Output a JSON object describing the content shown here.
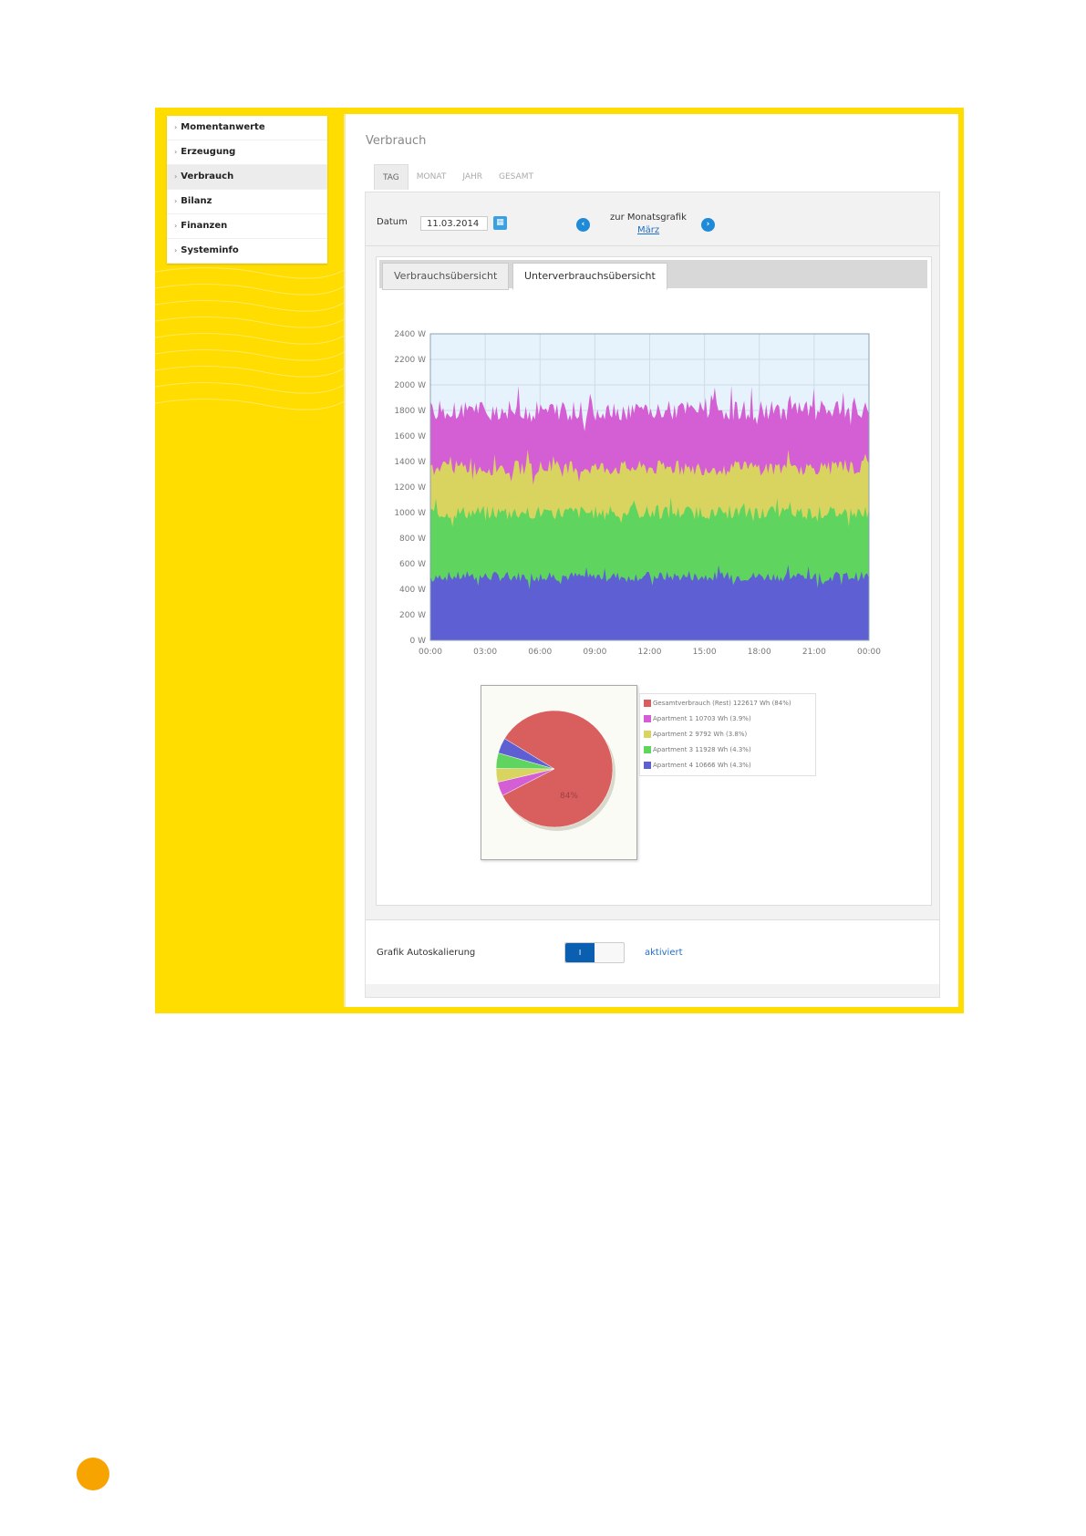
{
  "sidebar": {
    "items": [
      {
        "label": "Momentanwerte"
      },
      {
        "label": "Erzeugung"
      },
      {
        "label": "Verbrauch"
      },
      {
        "label": "Bilanz"
      },
      {
        "label": "Finanzen"
      },
      {
        "label": "Systeminfo"
      }
    ],
    "active_index": 2
  },
  "main": {
    "title": "Verbrauch",
    "tabs": [
      {
        "label": "TAG"
      },
      {
        "label": "MONAT"
      },
      {
        "label": "JAHR"
      },
      {
        "label": "GESAMT"
      }
    ],
    "date_label": "Datum",
    "date_value": "11.03.2014",
    "monat_text": "zur Monatsgrafik",
    "monat_link": "März",
    "subtabs": [
      {
        "label": "Verbrauchsübersicht"
      },
      {
        "label": "Unterverbrauchsübersicht"
      }
    ],
    "autoscale_label": "Grafik Autoskalierung",
    "autoscale_toggle": "I",
    "autoscale_state": "aktiviert"
  },
  "colors": {
    "frame": "#ffdd00",
    "apartment1": "#d45fd4",
    "apartment2": "#d9d45f",
    "apartment3": "#5fd45f",
    "apartment4": "#5f5fd4",
    "gesamt": "#d95f5f",
    "accent": "#1f8ad8"
  },
  "chart_data": [
    {
      "type": "area",
      "stacked": true,
      "x_ticks": [
        "00:00",
        "03:00",
        "06:00",
        "09:00",
        "12:00",
        "15:00",
        "18:00",
        "21:00",
        "00:00"
      ],
      "y_ticks": [
        "0 W",
        "200 W",
        "400 W",
        "600 W",
        "800 W",
        "1000 W",
        "1200 W",
        "1400 W",
        "1600 W",
        "1800 W",
        "2000 W",
        "2200 W",
        "2400 W"
      ],
      "ylim": [
        0,
        2400
      ],
      "grid": true,
      "series": [
        {
          "color": "#5f5fd4",
          "mean": 500,
          "jitter": 40
        },
        {
          "color": "#5fd45f",
          "mean": 1000,
          "jitter": 55
        },
        {
          "color": "#d9d45f",
          "mean": 1350,
          "jitter": 60
        },
        {
          "color": "#d45fd4",
          "mean": 1800,
          "jitter": 80
        }
      ]
    },
    {
      "type": "pie",
      "slices": [
        {
          "label": "Gesamtverbrauch (Rest) 122617 Wh (84%)",
          "value": 84,
          "color": "#d95f5f"
        },
        {
          "label": "Apartment 1 10703 Wh (3.9%)",
          "value": 3.9,
          "color": "#d45fd4"
        },
        {
          "label": "Apartment 2 9792 Wh (3.8%)",
          "value": 3.8,
          "color": "#d9d45f"
        },
        {
          "label": "Apartment 3 11928 Wh (4.3%)",
          "value": 4.3,
          "color": "#5fd45f"
        },
        {
          "label": "Apartment 4 10666 Wh (4.3%)",
          "value": 4.3,
          "color": "#5f5fd4"
        }
      ],
      "center_label": "84%"
    }
  ]
}
